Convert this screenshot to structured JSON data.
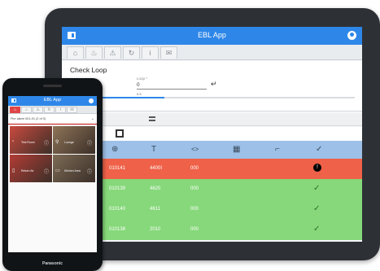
{
  "tablet": {
    "app_title": "EBL App",
    "tabs": [
      {
        "icon": "home-icon",
        "glyph": "⌂"
      },
      {
        "icon": "building-fire-icon",
        "glyph": "♨"
      },
      {
        "icon": "warning-icon",
        "glyph": "⚠"
      },
      {
        "icon": "loop-icon",
        "glyph": "↻"
      },
      {
        "icon": "info-icon",
        "glyph": "i"
      },
      {
        "icon": "chat-icon",
        "glyph": "✉"
      }
    ],
    "check_loop": {
      "heading": "Check Loop",
      "loop_label": "Loop *",
      "loop_value": "0",
      "progress_text": "0.5",
      "progress": 0.33
    },
    "table": {
      "header_icons": [
        {
          "name": "device-type-icon",
          "glyph": "⊕"
        },
        {
          "name": "text-type-icon",
          "glyph": "T"
        },
        {
          "name": "code-icon",
          "glyph": "<>"
        },
        {
          "name": "grid-module-icon",
          "glyph": "▦"
        },
        {
          "name": "signal-icon",
          "glyph": "⌐"
        },
        {
          "name": "check-status-icon",
          "glyph": "✓"
        }
      ],
      "rows": [
        {
          "address": "010141",
          "type": "4400I",
          "value": "000",
          "status": "!",
          "color": "#ef6148",
          "status_color": "#000000"
        },
        {
          "address": "010139",
          "type": "4620",
          "value": "000",
          "status": "✓",
          "color": "#86d87a",
          "status_color": "#2f6f2a"
        },
        {
          "address": "010140",
          "type": "4611",
          "value": "000",
          "status": "✓",
          "color": "#86d87a",
          "status_color": "#2f6f2a"
        },
        {
          "address": "010138",
          "type": "2010",
          "value": "000",
          "status": "✓",
          "color": "#86d87a",
          "status_color": "#2f6f2a"
        }
      ]
    }
  },
  "phone": {
    "app_title": "EBL App",
    "brand": "Panasonic",
    "filter_text": "Fire alarm 001-01 (2 of 3)",
    "tiles": [
      {
        "label": "Test Room",
        "color": "#c94a3f"
      },
      {
        "label": "Lounge",
        "color": "#8e7458"
      },
      {
        "label": "Return Air",
        "color": "#b23c35"
      },
      {
        "label": "Kitchen Area",
        "color": "#7c6b55"
      }
    ]
  },
  "colors": {
    "accent": "#2e87e8",
    "alarm": "#ef6148",
    "ok": "#86d87a",
    "header_row": "#9cc0e7"
  }
}
